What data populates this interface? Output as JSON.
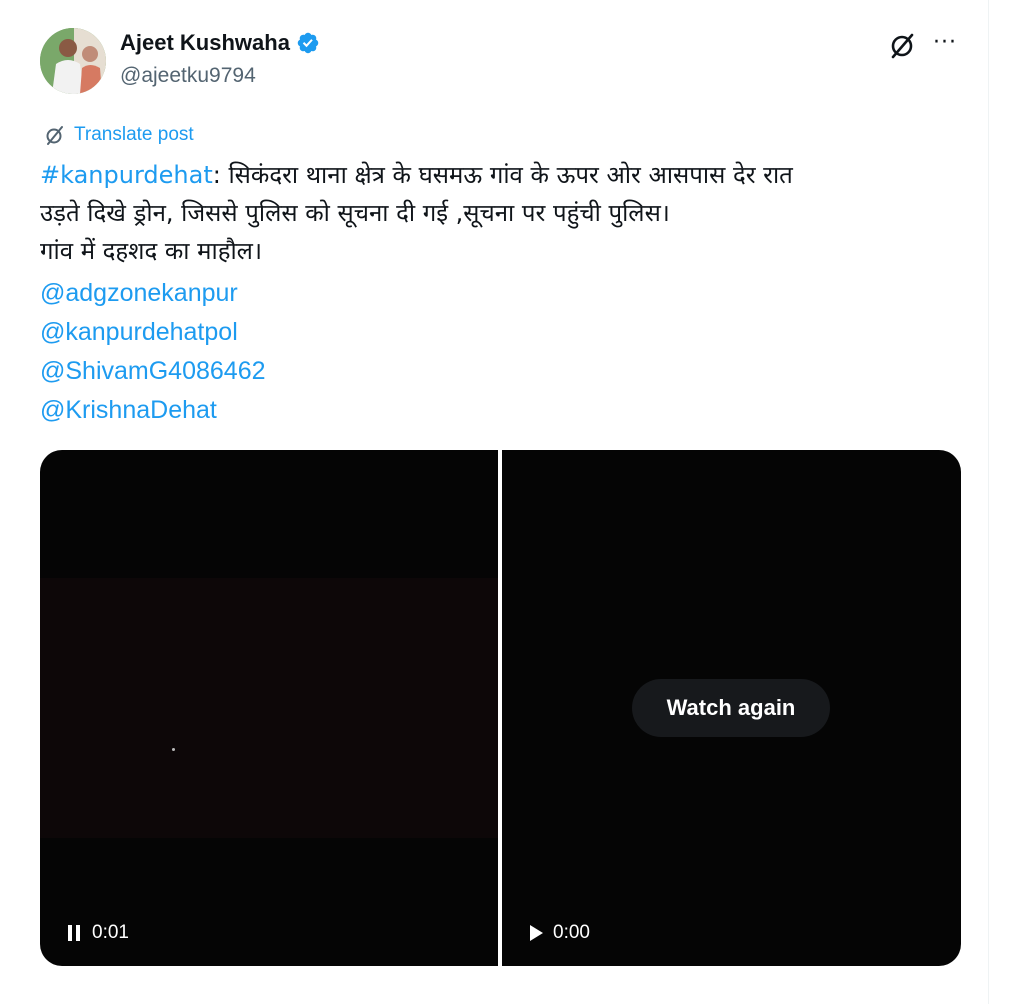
{
  "author": {
    "name": "Ajeet Kushwaha",
    "handle": "@ajeetku9794",
    "verified": true,
    "verified_color": "#1d9bf0"
  },
  "actions": {
    "grok_icon": "grok-slash-circle-icon",
    "more_icon": "more-dots-icon",
    "more_label": "···"
  },
  "translate": {
    "label": "Translate post",
    "icon": "grok-slash-circle-icon"
  },
  "post": {
    "hashtag": "#kanpurdehat",
    "line1_rest": ": सिकंदरा थाना क्षेत्र के घसमऊ गांव के ऊपर ओर आसपास देर रात",
    "line2": "उड़ते दिखे ड्रोन, जिससे पुलिस को सूचना दी गई ,सूचना पर पहुंची पुलिस।",
    "line3": "गांव में दहशद का माहौल।",
    "mentions": [
      "@adgzonekanpur",
      "@kanpurdehatpol",
      "@ShivamG4086462",
      "@KrishnaDehat"
    ]
  },
  "media": {
    "videos": [
      {
        "state": "playing",
        "control_icon": "pause-icon",
        "time": "0:01"
      },
      {
        "state": "ended",
        "control_icon": "play-icon",
        "time": "0:00",
        "overlay_button": "Watch again"
      }
    ]
  },
  "colors": {
    "link": "#1d9bf0",
    "secondary_text": "#536471",
    "primary_text": "#0f1419",
    "video_bg": "#050505"
  }
}
